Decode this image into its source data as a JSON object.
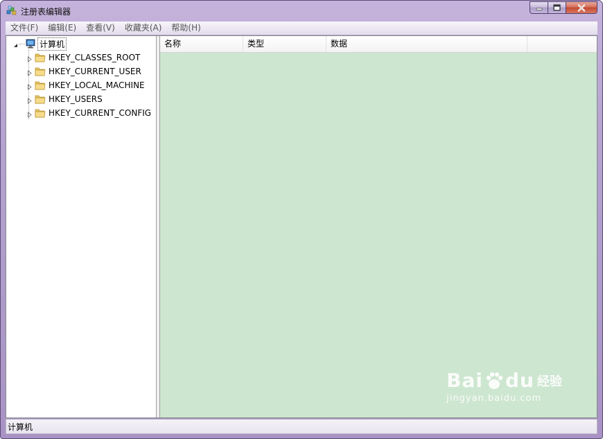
{
  "window": {
    "title": "注册表编辑器"
  },
  "menu": {
    "items": [
      "文件(F)",
      "编辑(E)",
      "查看(V)",
      "收藏夹(A)",
      "帮助(H)"
    ]
  },
  "tree": {
    "root_label": "计算机",
    "hives": [
      "HKEY_CLASSES_ROOT",
      "HKEY_CURRENT_USER",
      "HKEY_LOCAL_MACHINE",
      "HKEY_USERS",
      "HKEY_CURRENT_CONFIG"
    ]
  },
  "list": {
    "columns": [
      "名称",
      "类型",
      "数据"
    ]
  },
  "status": {
    "path": "计算机"
  },
  "watermark": {
    "brand_prefix": "Bai",
    "brand_suffix": "du",
    "brand_cn": "经验",
    "url": "jingyan.baidu.com"
  },
  "colors": {
    "list_background": "#cde6d0",
    "title_gradient": "#b6a3cf",
    "close_button": "#c34a33"
  }
}
